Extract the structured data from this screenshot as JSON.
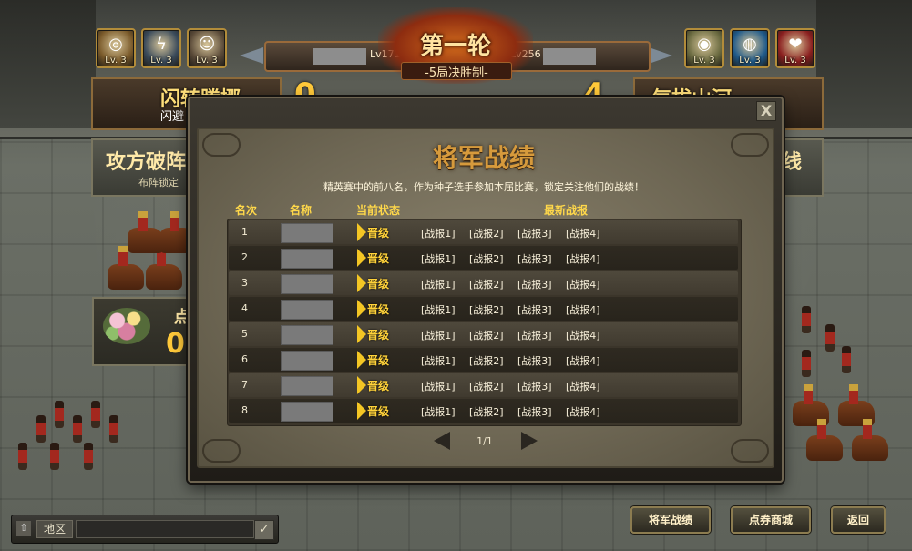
{
  "top": {
    "left_skills": [
      {
        "level": "Lv. 3",
        "glyph": "◎",
        "color": "#7a5a2a"
      },
      {
        "level": "Lv. 3",
        "glyph": "ϟ",
        "color": "#3a4a5a"
      },
      {
        "level": "Lv. 3",
        "glyph": "☺",
        "color": "#5a4a38"
      }
    ],
    "right_skills": [
      {
        "level": "Lv. 3",
        "glyph": "◉",
        "color": "#6a6a40"
      },
      {
        "level": "Lv. 3",
        "glyph": "◍",
        "color": "#1f5a8a"
      },
      {
        "level": "Lv. 3",
        "glyph": "❤",
        "color": "#8a1f1f"
      }
    ],
    "round_title": "第一轮",
    "round_subtitle": "-5局决胜制-",
    "left_level": "Lv171",
    "right_level": "Lv256"
  },
  "background": {
    "left_banner_title": "闪转腾挪",
    "left_banner_sub": "闪避",
    "left_score": "0",
    "right_score": "4",
    "right_banner_title": "气拔山河",
    "formation_title": "攻方破阵",
    "formation_sub": "布阵锁定",
    "right_panel_text": "线",
    "flower_label": "点",
    "flower_value": "0"
  },
  "modal": {
    "title": "将军战绩",
    "description": "精英赛中的前八名，作为种子选手参加本届比赛，锁定关注他们的战绩！",
    "headers": {
      "rank": "名次",
      "name": "名称",
      "status": "当前状态",
      "reports": "最新战报"
    },
    "rows": [
      {
        "rank": "1",
        "status": "晋级",
        "reports": [
          "[战报1]",
          "[战报2]",
          "[战报3]",
          "[战报4]"
        ]
      },
      {
        "rank": "2",
        "status": "晋级",
        "reports": [
          "[战报1]",
          "[战报2]",
          "[战报3]",
          "[战报4]"
        ]
      },
      {
        "rank": "3",
        "status": "晋级",
        "reports": [
          "[战报1]",
          "[战报2]",
          "[战报3]",
          "[战报4]"
        ]
      },
      {
        "rank": "4",
        "status": "晋级",
        "reports": [
          "[战报1]",
          "[战报2]",
          "[战报3]",
          "[战报4]"
        ]
      },
      {
        "rank": "5",
        "status": "晋级",
        "reports": [
          "[战报1]",
          "[战报2]",
          "[战报3]",
          "[战报4]"
        ]
      },
      {
        "rank": "6",
        "status": "晋级",
        "reports": [
          "[战报1]",
          "[战报2]",
          "[战报3]",
          "[战报4]"
        ]
      },
      {
        "rank": "7",
        "status": "晋级",
        "reports": [
          "[战报1]",
          "[战报2]",
          "[战报3]",
          "[战报4]"
        ]
      },
      {
        "rank": "8",
        "status": "晋级",
        "reports": [
          "[战报1]",
          "[战报2]",
          "[战报3]",
          "[战报4]"
        ]
      }
    ],
    "page": "1/1",
    "close_label": "X"
  },
  "bottom": {
    "chat_region": "地区",
    "chat_placeholder": "",
    "buttons": {
      "records": "将军战绩",
      "shop": "点券商城",
      "back": "返回"
    }
  }
}
